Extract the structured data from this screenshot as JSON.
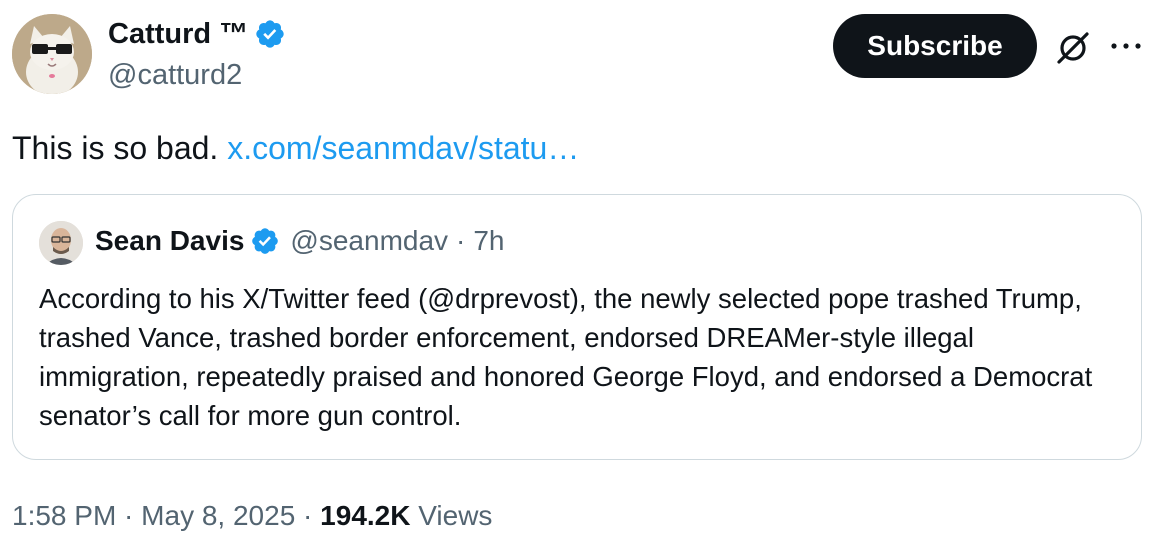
{
  "author": {
    "display_name": "Catturd ™",
    "handle": "@catturd2",
    "verified": true
  },
  "header_actions": {
    "subscribe_label": "Subscribe",
    "grok_icon": "grok-icon",
    "more_icon": "more-icon"
  },
  "tweet": {
    "text": "This is so bad. ",
    "link_text": "x.com/seanmdav/statu…"
  },
  "quoted_tweet": {
    "display_name": "Sean Davis",
    "handle": "@seanmdav",
    "separator": "·",
    "time": "7h",
    "body": "According to his X/Twitter feed (@drprevost), the newly selected pope trashed Trump, trashed Vance, trashed border enforcement, endorsed DREAMer-style illegal immigration, repeatedly praised and honored George Floyd, and endorsed a Democrat senator’s call for more gun control."
  },
  "meta": {
    "time": "1:58 PM",
    "sep1": " · ",
    "date": "May 8, 2025",
    "sep2": " · ",
    "views_count": "194.2K",
    "views_label": " Views"
  },
  "colors": {
    "link": "#1d9bf0",
    "verified": "#1d9bf0",
    "secondary_text": "#536471",
    "primary_text": "#0f1419",
    "border": "#cfd9de"
  }
}
